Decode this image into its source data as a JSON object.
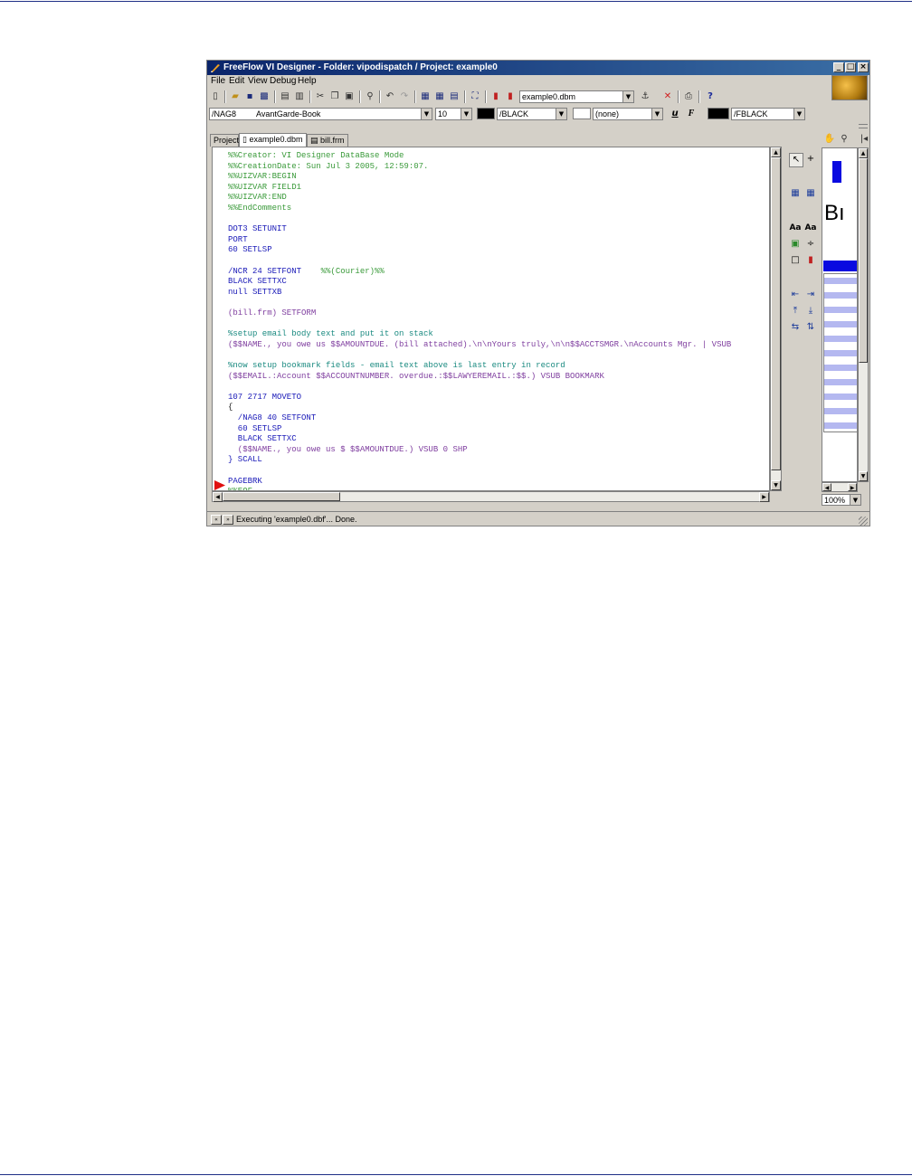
{
  "window": {
    "title": "FreeFlow VI Designer - Folder: vipodispatch / Project: example0"
  },
  "menu": [
    "File",
    "Edit",
    "View",
    "Debug",
    "Help"
  ],
  "toolbar": {
    "file_combo": "example0.dbm"
  },
  "format_bar": {
    "font_value": "/NAG8         AvantGarde-Book",
    "size_value": "10",
    "text_color_value": "/BLACK",
    "bg_color_value": "(none)",
    "bold_italic_u": "u",
    "bold_italic_f": "F",
    "fb_color_value": "/FBLACK",
    "colors": {
      "text": "#000000",
      "bg": "#ffffff",
      "fb": "#000000"
    }
  },
  "tabs": [
    {
      "label": "Project"
    },
    {
      "label": "example0.dbm"
    },
    {
      "label": "bill.frm"
    }
  ],
  "code_lines": [
    {
      "text": "%%Creator: VI Designer DataBase Mode",
      "kind": "green"
    },
    {
      "text": "%%CreationDate: Sun Jul 3 2005, 12:59:07.",
      "kind": "green"
    },
    {
      "text": "%%UIZVAR:BEGIN",
      "kind": "green"
    },
    {
      "text": "%%UIZVAR FIELD1",
      "kind": "green"
    },
    {
      "text": "%%UIZVAR:END",
      "kind": "green"
    },
    {
      "text": "%%EndComments",
      "kind": "green"
    },
    {
      "text": "",
      "kind": "black"
    },
    {
      "text": "DOT3 SETUNIT",
      "kind": "blue"
    },
    {
      "text": "PORT",
      "kind": "blue"
    },
    {
      "text": "60 SETLSP",
      "kind": "blue"
    },
    {
      "text": "",
      "kind": "black"
    },
    {
      "text": "/NCR 24 SETFONT    %%(Courier)%%",
      "kind": "mixed"
    },
    {
      "text": "BLACK SETTXC",
      "kind": "blue"
    },
    {
      "text": "null SETTXB",
      "kind": "blue"
    },
    {
      "text": "",
      "kind": "black"
    },
    {
      "text": "(bill.frm) SETFORM",
      "kind": "purple"
    },
    {
      "text": "",
      "kind": "black"
    },
    {
      "text": "%setup email body text and put it on stack",
      "kind": "teal"
    },
    {
      "text": "($$NAME., you owe us $$AMOUNTDUE. (bill attached).\\n\\nYours truly,\\n\\n$$ACCTSMGR.\\nAccounts Mgr. | VSUB",
      "kind": "purple"
    },
    {
      "text": "",
      "kind": "black"
    },
    {
      "text": "%now setup bookmark fields - email text above is last entry in record",
      "kind": "teal"
    },
    {
      "text": "($$EMAIL.:Account $$ACCOUNTNUMBER. overdue.:$$LAWYEREMAIL.:$$.) VSUB BOOKMARK",
      "kind": "purple"
    },
    {
      "text": "",
      "kind": "black"
    },
    {
      "text": "107 2717 MOVETO",
      "kind": "blue"
    },
    {
      "text": "{",
      "kind": "black"
    },
    {
      "text": "  /NAG8 40 SETFONT",
      "kind": "blue"
    },
    {
      "text": "  60 SETLSP",
      "kind": "blue"
    },
    {
      "text": "  BLACK SETTXC",
      "kind": "blue"
    },
    {
      "text": "  ($$NAME., you owe us $ $$AMOUNTDUE.) VSUB 0 SHP",
      "kind": "purple"
    },
    {
      "text": "} SCALL",
      "kind": "blue"
    },
    {
      "text": "",
      "kind": "black"
    },
    {
      "text": "PAGEBRK",
      "kind": "blue"
    },
    {
      "text": "%%EOF",
      "kind": "green"
    }
  ],
  "preview": {
    "text": "Bı",
    "zoom_value": "100%"
  },
  "status": {
    "message": "Executing 'example0.dbf'... Done."
  }
}
